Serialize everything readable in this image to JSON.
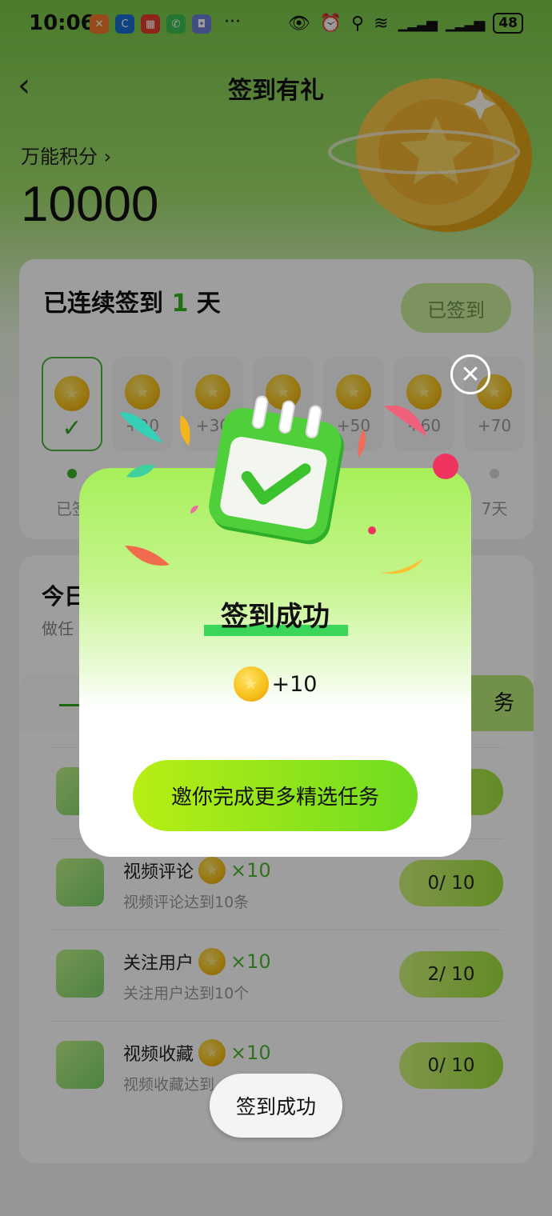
{
  "status_bar": {
    "time": "10:06",
    "battery": "48"
  },
  "header": {
    "title": "签到有礼"
  },
  "points": {
    "label": "万能积分 ›",
    "value": "10000"
  },
  "signin": {
    "title_prefix": "已连续签到 ",
    "streak": "1",
    "title_suffix": " 天",
    "button": "已签到",
    "days": [
      {
        "points": "",
        "label": "已签"
      },
      {
        "points": "+20",
        "label": ""
      },
      {
        "points": "+30",
        "label": ""
      },
      {
        "points": "",
        "label": ""
      },
      {
        "points": "+50",
        "label": ""
      },
      {
        "points": "+60",
        "label": ""
      },
      {
        "points": "+70",
        "label": "7天"
      }
    ]
  },
  "tasks": {
    "title": "今日",
    "subtitle": "做任",
    "tab_right": "务",
    "items": [
      {
        "name": "视频评论",
        "mult": "×10",
        "desc": "视频评论达到10条",
        "progress": "0/ 10"
      },
      {
        "name": "关注用户",
        "mult": "×10",
        "desc": "关注用户达到10个",
        "progress": "2/ 10"
      },
      {
        "name": "视频收藏",
        "mult": "×10",
        "desc": "视频收藏达到",
        "progress": "0/ 10"
      }
    ]
  },
  "modal": {
    "title": "签到成功",
    "reward": "+10",
    "cta": "邀你完成更多精选任务",
    "close_icon": "close-icon"
  },
  "toast": {
    "text": "签到成功"
  },
  "colors": {
    "accent_green": "#35b71e",
    "cta_start": "#b8ee14",
    "cta_end": "#6fdc21"
  }
}
